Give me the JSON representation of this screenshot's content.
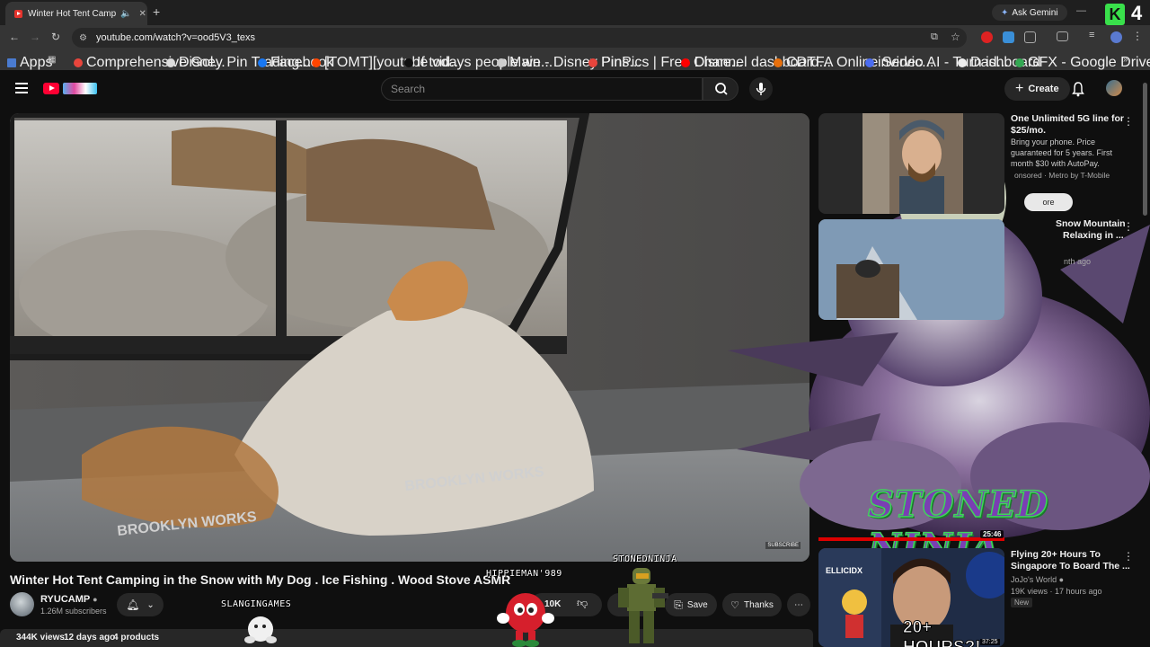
{
  "browser": {
    "tab_title": "Winter Hot Tent Camping i",
    "url": "youtube.com/watch?v=ood5V3_texs",
    "ask_gemini": "Ask Gemini",
    "bookmarks": [
      "Apps",
      "Comprehensive Gol...",
      "Disney Pin Trading...",
      "Facebook",
      "[TOMT][youtube vid...",
      "If todays people we...",
      "Main - Disney Pins...",
      "PinPics | Free Disne...",
      "Channel dashboard...",
      "CDTFA Online Servic...",
      "invideo AI - Turn id...",
      "Dashboard",
      "GFX - Google Drive"
    ],
    "bookmark_colors": [
      "#4a7bd0",
      "#e8453c",
      "#ddd",
      "#1877f2",
      "#ff4500",
      "#111",
      "#ccc",
      "#e8453c",
      "#ff0000",
      "#e8700c",
      "#4b6cf0",
      "#eee",
      "#34a853"
    ]
  },
  "youtube": {
    "search_placeholder": "Search",
    "create_label": "Create",
    "video_title": "Winter Hot Tent Camping in the Snow with My Dog . Ice Fishing . Wood Stove ASMR",
    "channel_name": "RYUCAMP",
    "subscribers": "1.26M subscribers",
    "like_count": "10K",
    "save_label": "Save",
    "thanks_label": "Thanks",
    "views": "344K views",
    "age": "12 days ago",
    "products": "4 products",
    "subscribe_watermark": "SUBSCRIBE"
  },
  "overlay": {
    "user1": "HIPPIEMAN'989",
    "user2": "STONEDNINJA",
    "user3": "SLANGINGAMES",
    "brand": "STONED NINJA",
    "badge_letter": "K",
    "badge_number": "4"
  },
  "sidebar": {
    "ad": {
      "title_line1": "One Unlimited 5G line for",
      "title_line2": "$25/mo.",
      "desc1": "Bring your phone. Price",
      "desc2": "guaranteed for 5 years. First",
      "desc3": "month $30 with AutoPay.",
      "sponsor": "onsored · Metro by T-Mobile",
      "button": "ore"
    },
    "item2": {
      "title1": "Snow Mountain",
      "title2": "Relaxing in ...",
      "meta": "nth ago"
    },
    "item3": {
      "duration": "25:46",
      "title1": "Flying 20+ Hours To",
      "title2": "Singapore To Board The ...",
      "channel": "JoJo's World",
      "meta": "19K views · 17 hours ago",
      "badge": "New",
      "thumb_text": "20+ HOURS?!",
      "thumb_brand": "ELLICIDX",
      "duration2": "37:25"
    }
  }
}
